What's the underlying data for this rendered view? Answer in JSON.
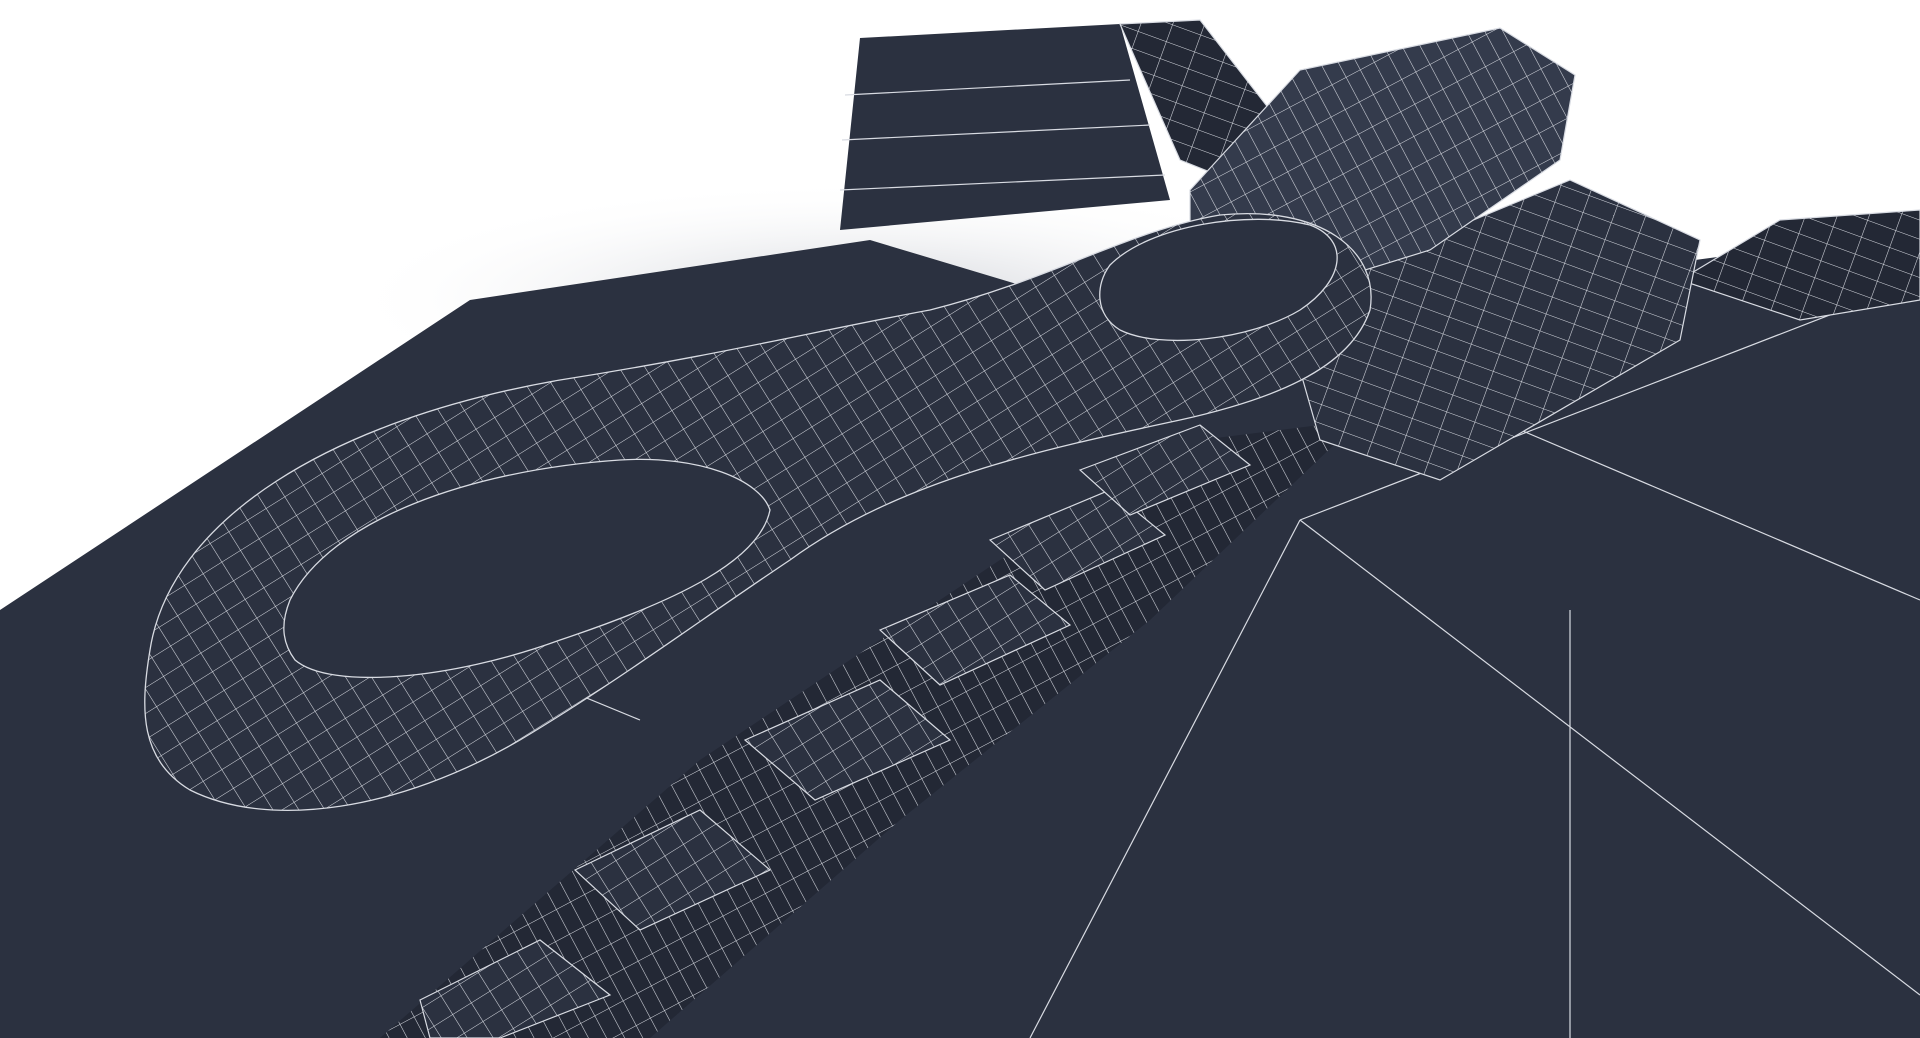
{
  "image": {
    "subject": "zipper-wireframe-render",
    "colors": {
      "background": "#ffffff",
      "mesh_fill": "#2b3140",
      "mesh_fill_shade": "#232835",
      "mesh_fill_light": "#343b4c",
      "wire": "#d8dbe2",
      "shadow": "#cfd2d8"
    }
  }
}
